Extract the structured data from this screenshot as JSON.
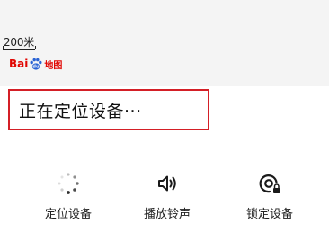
{
  "map": {
    "scale_label": "200米",
    "logo_text": "Bai",
    "logo_suffix": "地图"
  },
  "status": {
    "message": "正在定位设备···"
  },
  "actions": [
    {
      "label": "定位设备",
      "icon": "loading-spinner-icon"
    },
    {
      "label": "播放铃声",
      "icon": "speaker-icon"
    },
    {
      "label": "锁定设备",
      "icon": "lock-target-icon"
    }
  ],
  "colors": {
    "highlight_border": "#d41f26",
    "logo_red": "#e10602",
    "logo_blue": "#2a63d4",
    "map_bg": "#f4f4f4"
  }
}
